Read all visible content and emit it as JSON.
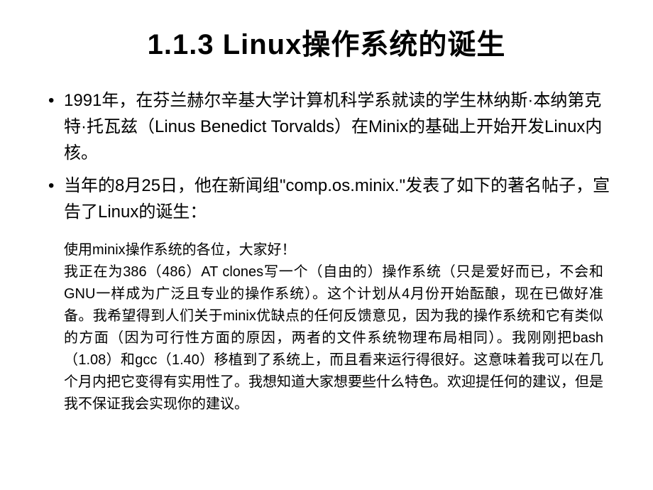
{
  "slide": {
    "title": "1.1.3  Linux操作系统的诞生",
    "bullets": [
      "1991年，在芬兰赫尔辛基大学计算机科学系就读的学生林纳斯·本纳第克特·托瓦兹（Linus Benedict Torvalds）在Minix的基础上开始开发Linux内核。",
      "当年的8月25日，他在新闻组\"comp.os.minix.\"发表了如下的著名帖子，宣告了Linux的诞生："
    ],
    "quote": {
      "greeting": "使用minix操作系统的各位，大家好！",
      "body": "我正在为386（486）AT clones写一个（自由的）操作系统（只是爱好而已，不会和GNU一样成为广泛且专业的操作系统）。这个计划从4月份开始酝酿，现在已做好准备。我希望得到人们关于minix优缺点的任何反馈意见，因为我的操作系统和它有类似的方面（因为可行性方面的原因，两者的文件系统物理布局相同）。我刚刚把bash（1.08）和gcc（1.40）移植到了系统上，而且看来运行得很好。这意味着我可以在几个月内把它变得有实用性了。我想知道大家想要些什么特色。欢迎提任何的建议，但是我不保证我会实现你的建议。"
    }
  }
}
